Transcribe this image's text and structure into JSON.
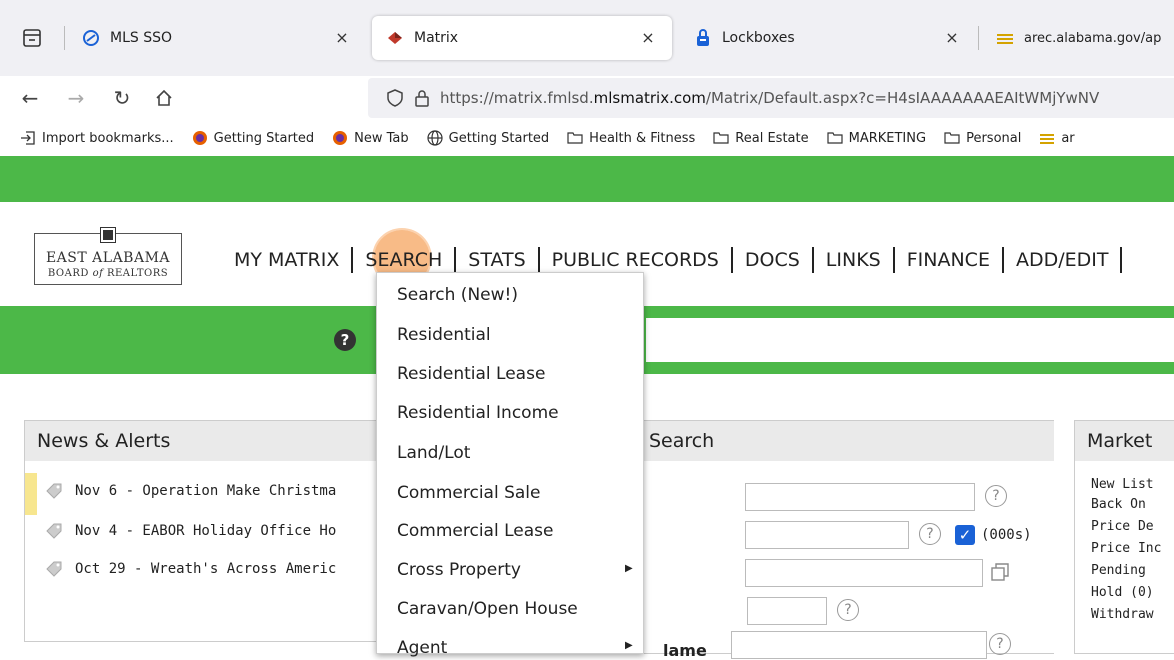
{
  "browser": {
    "tabs": [
      {
        "title": "MLS SSO",
        "close": "×"
      },
      {
        "title": "Matrix",
        "close": "×"
      },
      {
        "title": "Lockboxes",
        "close": "×"
      },
      {
        "title": "arec.alabama.gov/ap"
      }
    ],
    "url": {
      "prefix": "https://matrix.fmlsd.",
      "domain": "mlsmatrix.com",
      "path": "/Matrix/Default.aspx?c=H4sIAAAAAAAEAItWMjYwNV"
    },
    "bookmarks": [
      {
        "label": "Import bookmarks...",
        "icon": "import-icon"
      },
      {
        "label": "Getting Started",
        "icon": "firefox-icon"
      },
      {
        "label": "New Tab",
        "icon": "firefox-icon"
      },
      {
        "label": "Getting Started",
        "icon": "globe-icon"
      },
      {
        "label": "Health & Fitness",
        "icon": "folder-icon"
      },
      {
        "label": "Real Estate",
        "icon": "folder-icon"
      },
      {
        "label": "MARKETING",
        "icon": "folder-icon"
      },
      {
        "label": "Personal",
        "icon": "folder-icon"
      },
      {
        "label": "ar",
        "icon": "arec-icon"
      }
    ]
  },
  "logo": {
    "line1": "EAST ALABAMA",
    "line2_a": "BOARD ",
    "line2_of": "of",
    "line2_b": " REALTORS"
  },
  "nav": [
    "MY MATRIX",
    "SEARCH",
    "STATS",
    "PUBLIC RECORDS",
    "DOCS",
    "LINKS",
    "FINANCE",
    "ADD/EDIT"
  ],
  "help_glyph": "?",
  "news": {
    "title": "News & Alerts",
    "items": [
      "Nov 6 - Operation Make Christma",
      "Nov 4 - EABOR Holiday Office Ho",
      "Oct 29 - Wreath's Across Americ"
    ]
  },
  "search_panel": {
    "title": "s Search",
    "checkbox_label": "(000s)",
    "name_label": "lame",
    "qmark": "?"
  },
  "market": {
    "title": "Market",
    "lines": [
      "New List",
      "Back On",
      "Price De",
      "Price Inc",
      "Pending",
      "Hold (0)",
      "Withdraw"
    ]
  },
  "dropdown": {
    "items": [
      {
        "label": "Search (New!)",
        "submenu": false
      },
      {
        "label": "Residential",
        "submenu": false
      },
      {
        "label": "Residential Lease",
        "submenu": false
      },
      {
        "label": "Residential Income",
        "submenu": false
      },
      {
        "label": "Land/Lot",
        "submenu": false
      },
      {
        "label": "Commercial Sale",
        "submenu": false
      },
      {
        "label": "Commercial Lease",
        "submenu": false
      },
      {
        "label": "Cross Property",
        "submenu": true
      },
      {
        "label": "Caravan/Open House",
        "submenu": false
      },
      {
        "label": "Agent",
        "submenu": true
      }
    ]
  },
  "colors": {
    "green": "#4cb848",
    "highlight": "#f59646",
    "checkbox": "#1a62d6",
    "news_marker": "#f7e68f"
  }
}
